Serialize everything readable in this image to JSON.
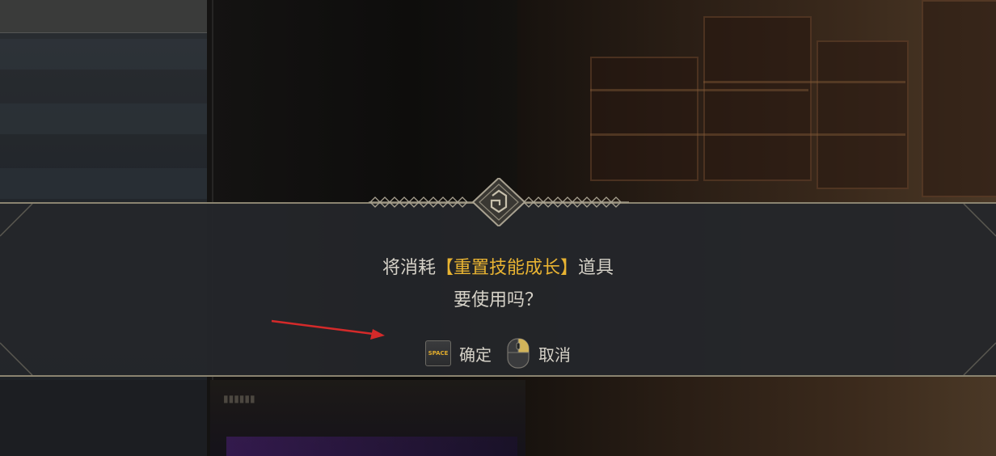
{
  "dialog": {
    "line1_prefix": "将消耗",
    "item_name": "【重置技能成长】",
    "line1_suffix": "道具",
    "line2": "要使用吗？"
  },
  "actions": {
    "confirm": {
      "key_label": "SPACE",
      "label": "确定"
    },
    "cancel": {
      "label": "取消"
    }
  },
  "colors": {
    "highlight": "#e8b332",
    "text": "#d6d2c8",
    "border": "#8b8470",
    "annotation_arrow": "#d42a2a"
  },
  "icons": {
    "emblem": "ornament-emblem-icon",
    "space_key": "space-key-icon",
    "mouse": "mouse-right-click-icon",
    "annotation": "red-arrow-icon"
  }
}
